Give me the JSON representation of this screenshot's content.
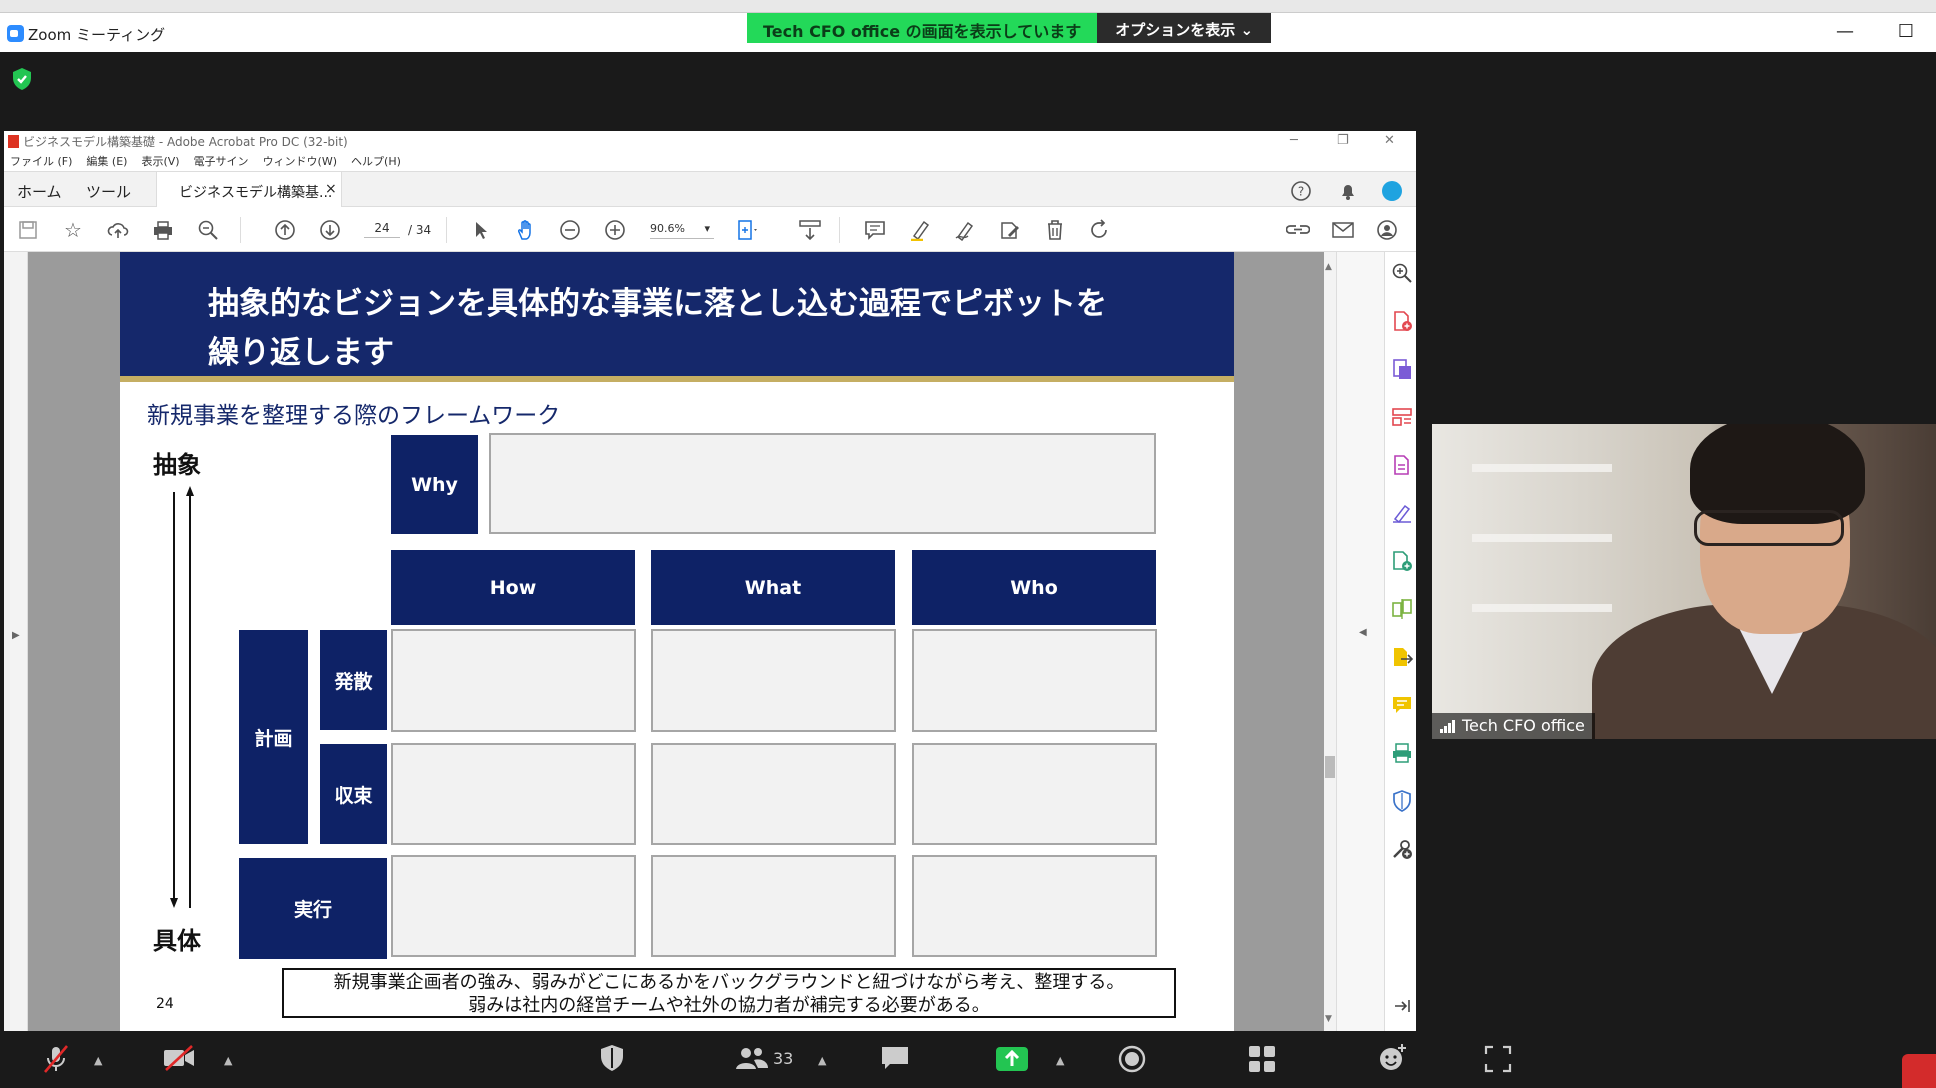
{
  "zoom": {
    "title": "Zoom ミーティング",
    "share_banner": "Tech CFO office の画面を表示しています",
    "options_button": "オプションを表示",
    "minimize": "—",
    "maximize": "☐"
  },
  "acrobat": {
    "window_title": "ビジネスモデル構築基礎 - Adobe Acrobat Pro DC (32-bit)",
    "menu": [
      "ファイル (F)",
      "編集 (E)",
      "表示(V)",
      "電子サイン",
      "ウィンドウ(W)",
      "ヘルプ(H)"
    ],
    "tabs": {
      "home": "ホーム",
      "tools": "ツール",
      "document": "ビジネスモデル構築基...",
      "close": "×"
    },
    "page_current": "24",
    "page_total": "/ 34",
    "zoom_level": "90.6%"
  },
  "slide": {
    "title_line1": "抽象的なビジョンを具体的な事業に落とし込む過程でピボットを",
    "title_line2": "繰り返します",
    "subtitle": "新規事業を整理する際のフレームワーク",
    "axis_top": "抽象",
    "axis_bottom": "具体",
    "why": "Why",
    "columns": [
      "How",
      "What",
      "Who"
    ],
    "plan": "計画",
    "diverge": "発散",
    "converge": "収束",
    "execute": "実行",
    "footnote_line1": "新規事業企画者の強み、弱みがどこにあるかをバックグラウンドと紐づけながら考え、整理する。",
    "footnote_line2": "弱みは社内の経営チームや社外の協力者が補完する必要がある。",
    "page_number": "24"
  },
  "video": {
    "participant_name": "Tech CFO office"
  },
  "controls": {
    "participants_count": "33"
  },
  "colors": {
    "navy": "#0e2266",
    "gold": "#c5ae63",
    "share_green": "#23d959"
  }
}
